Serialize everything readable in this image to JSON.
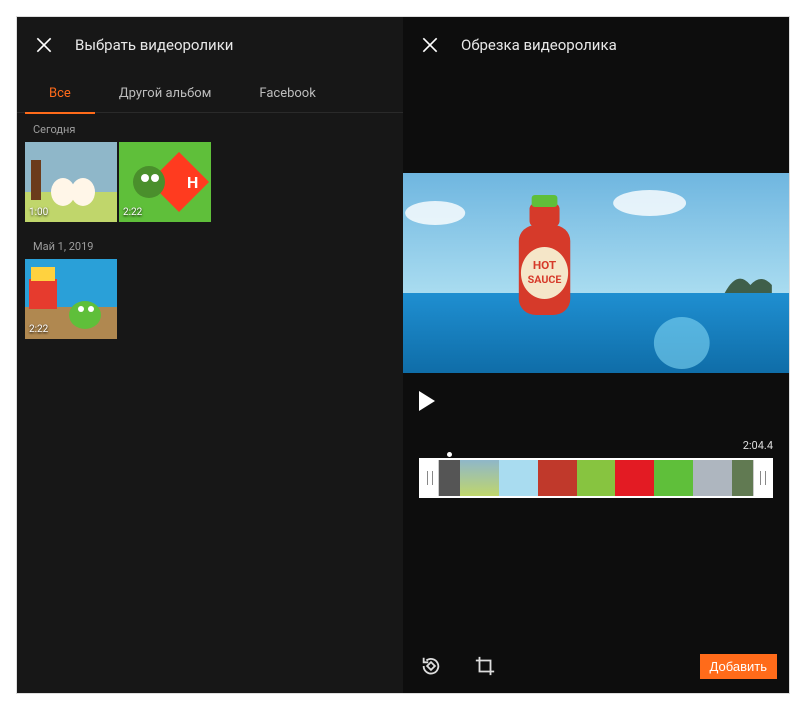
{
  "left": {
    "title": "Выбрать видеоролики",
    "tabs": [
      {
        "label": "Все",
        "active": true
      },
      {
        "label": "Другой альбом",
        "active": false
      },
      {
        "label": "Facebook",
        "active": false
      }
    ],
    "sections": [
      {
        "label": "Сегодня",
        "items": [
          {
            "duration": "1:00"
          },
          {
            "duration": "2:22"
          }
        ]
      },
      {
        "label": "Май 1, 2019",
        "items": [
          {
            "duration": "2:22"
          }
        ]
      }
    ]
  },
  "right": {
    "title": "Обрезка видеоролика",
    "timecode": "2:04.4",
    "add_label": "Добавить",
    "tool_icons": [
      "rotate-icon",
      "crop-icon"
    ]
  },
  "colors": {
    "accent": "#ff6b1a"
  }
}
